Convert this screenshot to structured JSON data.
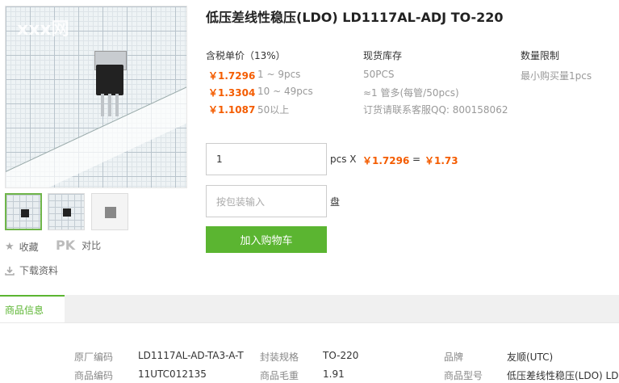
{
  "gallery": {
    "watermark": "xxx网",
    "thumbnails": [
      {
        "name": "thumb-1"
      },
      {
        "name": "thumb-2"
      },
      {
        "name": "thumb-3"
      }
    ]
  },
  "actions": {
    "favorite": "收藏",
    "pk": "PK",
    "compare": "对比",
    "download": "下载资料"
  },
  "product": {
    "title": "低压差线性稳压(LDO) LD1117AL-ADJ TO-220"
  },
  "pricing": {
    "header": "含税单价（13%）",
    "tiers": [
      {
        "price": "￥1.7296",
        "qty": "1 ~ 9pcs"
      },
      {
        "price": "￥1.3304",
        "qty": "10 ~ 49pcs"
      },
      {
        "price": "￥1.1087",
        "qty": "50以上"
      }
    ]
  },
  "stock": {
    "header": "现货库存",
    "amount": "50PCS",
    "package": "≈1 管多(每管/50pcs)",
    "contact": "订货请联系客服QQ: 800158062"
  },
  "limit": {
    "header": "数量限制",
    "min": "最小购买量1pcs"
  },
  "order": {
    "quantity": "1",
    "unit": "pcs X",
    "unit_price": "￥1.7296",
    "equals": "=",
    "total": "￥1.73",
    "pack_placeholder": "按包装输入",
    "pack_unit": "盘",
    "add_to_cart": "加入购物车"
  },
  "tabs": {
    "info": "商品信息"
  },
  "specs": {
    "rows": [
      [
        {
          "label": "原厂编码",
          "value": "LD1117AL-AD-TA3-A-T"
        },
        {
          "label": "封装规格",
          "value": "TO-220"
        },
        {
          "label": "品牌",
          "value": "友顺(UTC)"
        }
      ],
      [
        {
          "label": "商品编码",
          "value": "11UTC012135"
        },
        {
          "label": "商品毛重",
          "value": "1.91"
        },
        {
          "label": "商品型号",
          "value": "低压差线性稳压(LDO) LD..."
        }
      ]
    ]
  },
  "colors": {
    "accent": "#5bb531",
    "price": "#f45c00"
  }
}
